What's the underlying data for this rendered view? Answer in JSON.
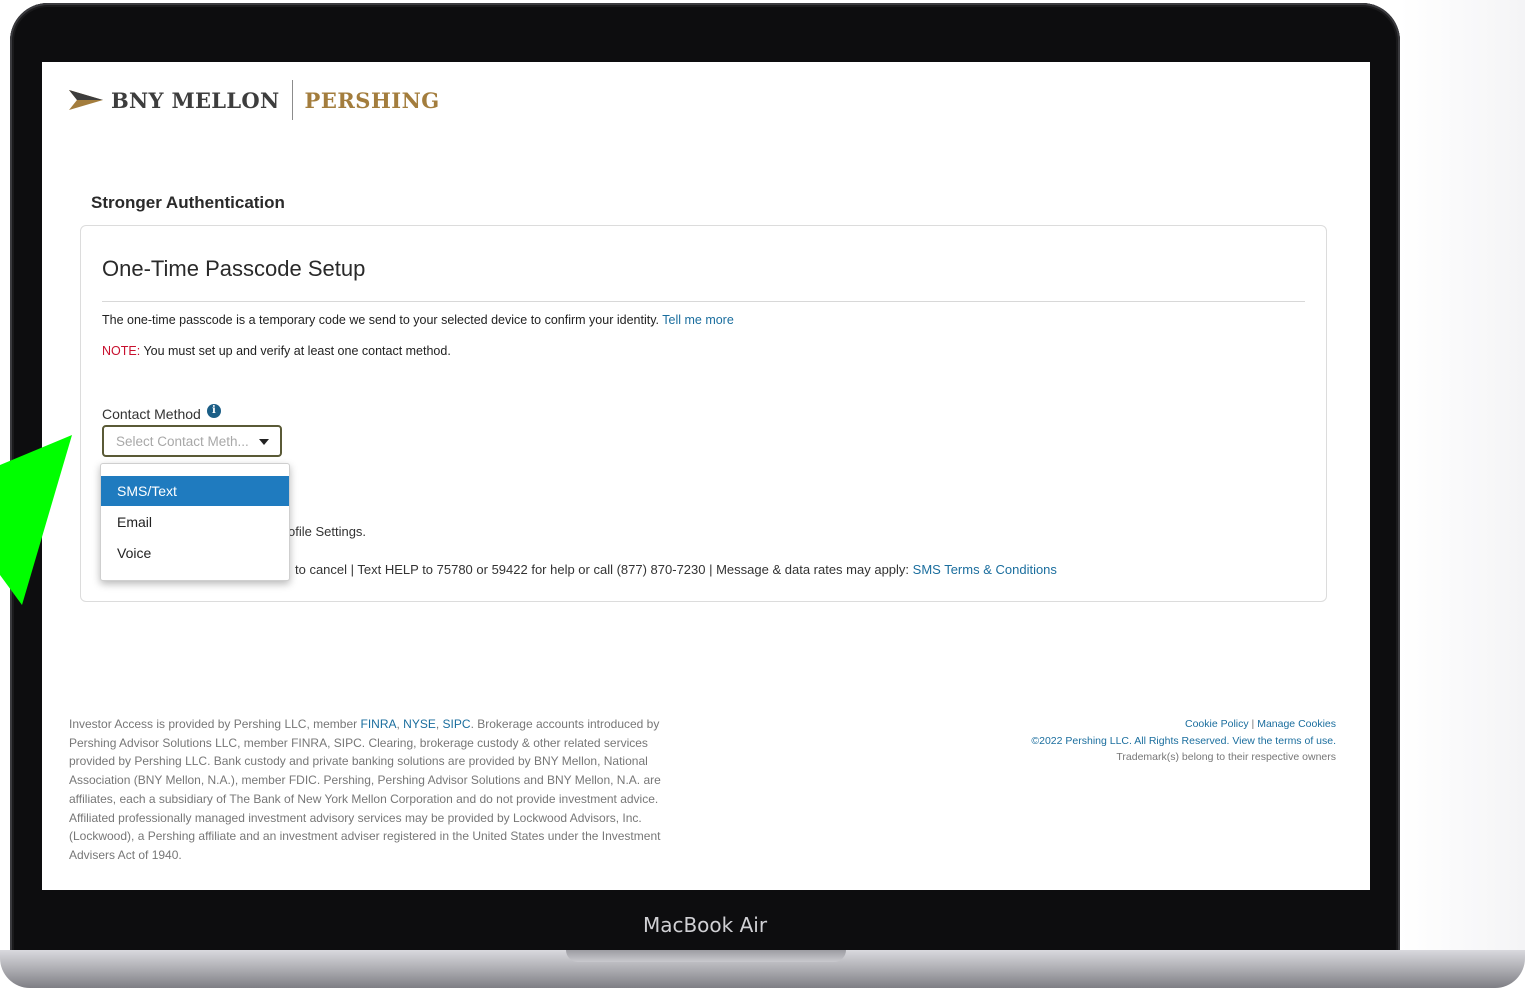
{
  "device": {
    "label": "MacBook Air"
  },
  "logo": {
    "primary": "BNY MELLON",
    "secondary": "PERSHING"
  },
  "page": {
    "section_title": "Stronger Authentication"
  },
  "card": {
    "title": "One-Time Passcode Setup",
    "description": "The one-time passcode is a temporary code we send to your selected device to confirm your identity.",
    "tell_more_link": "Tell me more",
    "note_label": "NOTE:",
    "note_text": "You must set up and verify at least one contact method.",
    "contact_method_label": "Contact Method",
    "select_placeholder": "Select Contact Meth...",
    "partial_profile_text": "ofile Settings.",
    "sms_info_text": "to cancel | Text HELP to 75780 or 59422 for help or call (877) 870-7230 | Message & data rates may apply:",
    "sms_terms_link": "SMS Terms & Conditions"
  },
  "dropdown": {
    "options": [
      "SMS/Text",
      "Email",
      "Voice"
    ],
    "highlighted": "SMS/Text"
  },
  "footer": {
    "left_intro": "Investor Access is provided by Pershing LLC, member",
    "links": [
      "FINRA",
      "NYSE",
      "SIPC"
    ],
    "left_body": "Brokerage accounts introduced by Pershing Advisor Solutions LLC, member FINRA, SIPC. Clearing, brokerage custody & other related services provided by Pershing LLC. Bank custody and private banking solutions are provided by BNY Mellon, National Association (BNY Mellon, N.A.), member FDIC. Pershing, Pershing Advisor Solutions and BNY Mellon, N.A. are affiliates, each a subsidiary of The Bank of New York Mellon Corporation and do not provide investment advice. Affiliated professionally managed investment advisory services may be provided by Lockwood Advisors, Inc. (Lockwood), a Pershing affiliate and an investment adviser registered in the United States under the Investment Advisers Act of 1940.",
    "cookie_policy": "Cookie Policy",
    "manage_cookies": "Manage Cookies",
    "copyright": "©2022 Pershing LLC. All Rights Reserved.",
    "terms_link": "View the terms of use.",
    "trademark": "Trademark(s) belong to their respective owners"
  },
  "colors": {
    "brand_gold": "#a37d3d",
    "link_blue": "#1b6e9e",
    "note_red": "#c8102e",
    "highlight_blue": "#1f7bbf",
    "pointer_green": "#00ff00"
  }
}
